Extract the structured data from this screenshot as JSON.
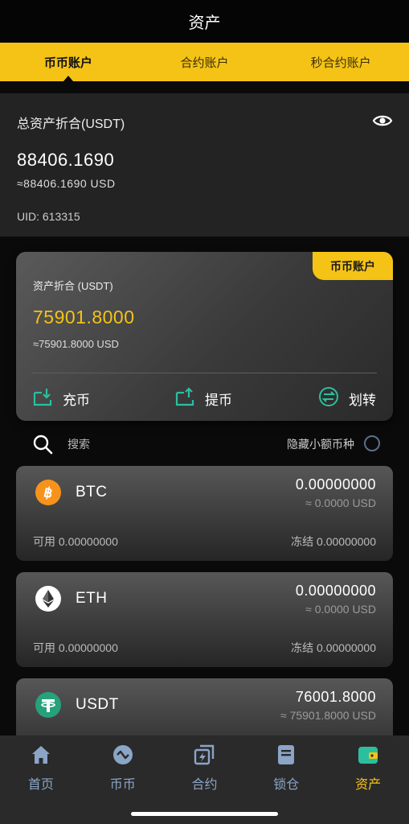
{
  "header": {
    "title": "资产"
  },
  "tabs": [
    {
      "label": "币币账户",
      "active": true
    },
    {
      "label": "合约账户",
      "active": false
    },
    {
      "label": "秒合约账户",
      "active": false
    }
  ],
  "summary": {
    "label": "总资产折合(USDT)",
    "total": "88406.1690",
    "approx": "≈88406.1690 USD",
    "uid": "UID: 613315"
  },
  "account_card": {
    "badge": "币币账户",
    "label": "资产折合 (USDT)",
    "value": "75901.8000",
    "approx": "≈75901.8000 USD",
    "actions": {
      "deposit": "充币",
      "withdraw": "提币",
      "transfer": "划转"
    }
  },
  "search": {
    "label": "搜索",
    "hide_small": "隐藏小额币种"
  },
  "coins": [
    {
      "symbol": "BTC",
      "amount": "0.00000000",
      "usd": "≈ 0.0000 USD",
      "available": "可用 0.00000000",
      "frozen": "冻结 0.00000000",
      "icon": "btc-icon",
      "color": "#f7931a"
    },
    {
      "symbol": "ETH",
      "amount": "0.00000000",
      "usd": "≈ 0.0000 USD",
      "available": "可用 0.00000000",
      "frozen": "冻结 0.00000000",
      "icon": "eth-icon",
      "color": "#ffffff"
    },
    {
      "symbol": "USDT",
      "amount": "76001.8000",
      "usd": "≈ 75901.8000 USD",
      "icon": "usdt-icon",
      "color": "#26a17b"
    }
  ],
  "nav": [
    {
      "label": "首页",
      "icon": "home-icon",
      "active": false
    },
    {
      "label": "币币",
      "icon": "exchange-icon",
      "active": false
    },
    {
      "label": "合约",
      "icon": "contract-icon",
      "active": false
    },
    {
      "label": "锁仓",
      "icon": "lock-position-icon",
      "active": false
    },
    {
      "label": "资产",
      "icon": "wallet-icon",
      "active": true
    }
  ],
  "colors": {
    "accent": "#f5c316",
    "nav_inactive": "#8ba5c7",
    "action_icon": "#2bbf9f"
  }
}
